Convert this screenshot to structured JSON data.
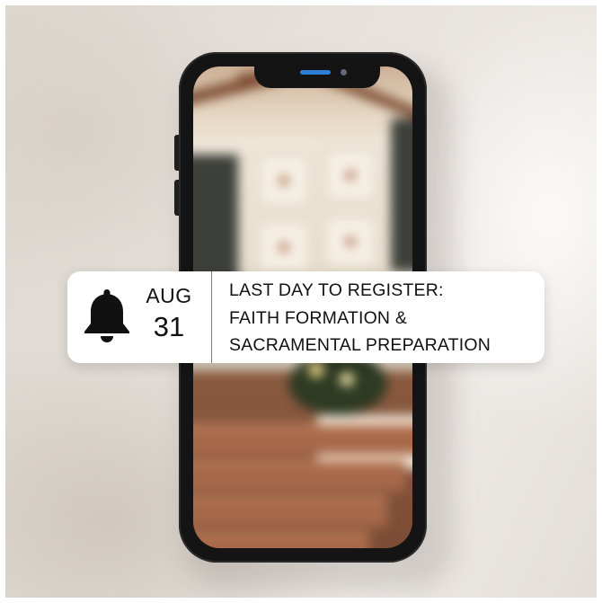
{
  "notification": {
    "icon": "bell-icon",
    "date": {
      "month": "AUG",
      "day": "31"
    },
    "lines": [
      "LAST DAY TO REGISTER:",
      "FAITH FORMATION &",
      "SACRAMENTAL  PREPARATION"
    ]
  },
  "phone": {
    "speaker_color": "#2e7fd6",
    "body_color": "#141414"
  }
}
